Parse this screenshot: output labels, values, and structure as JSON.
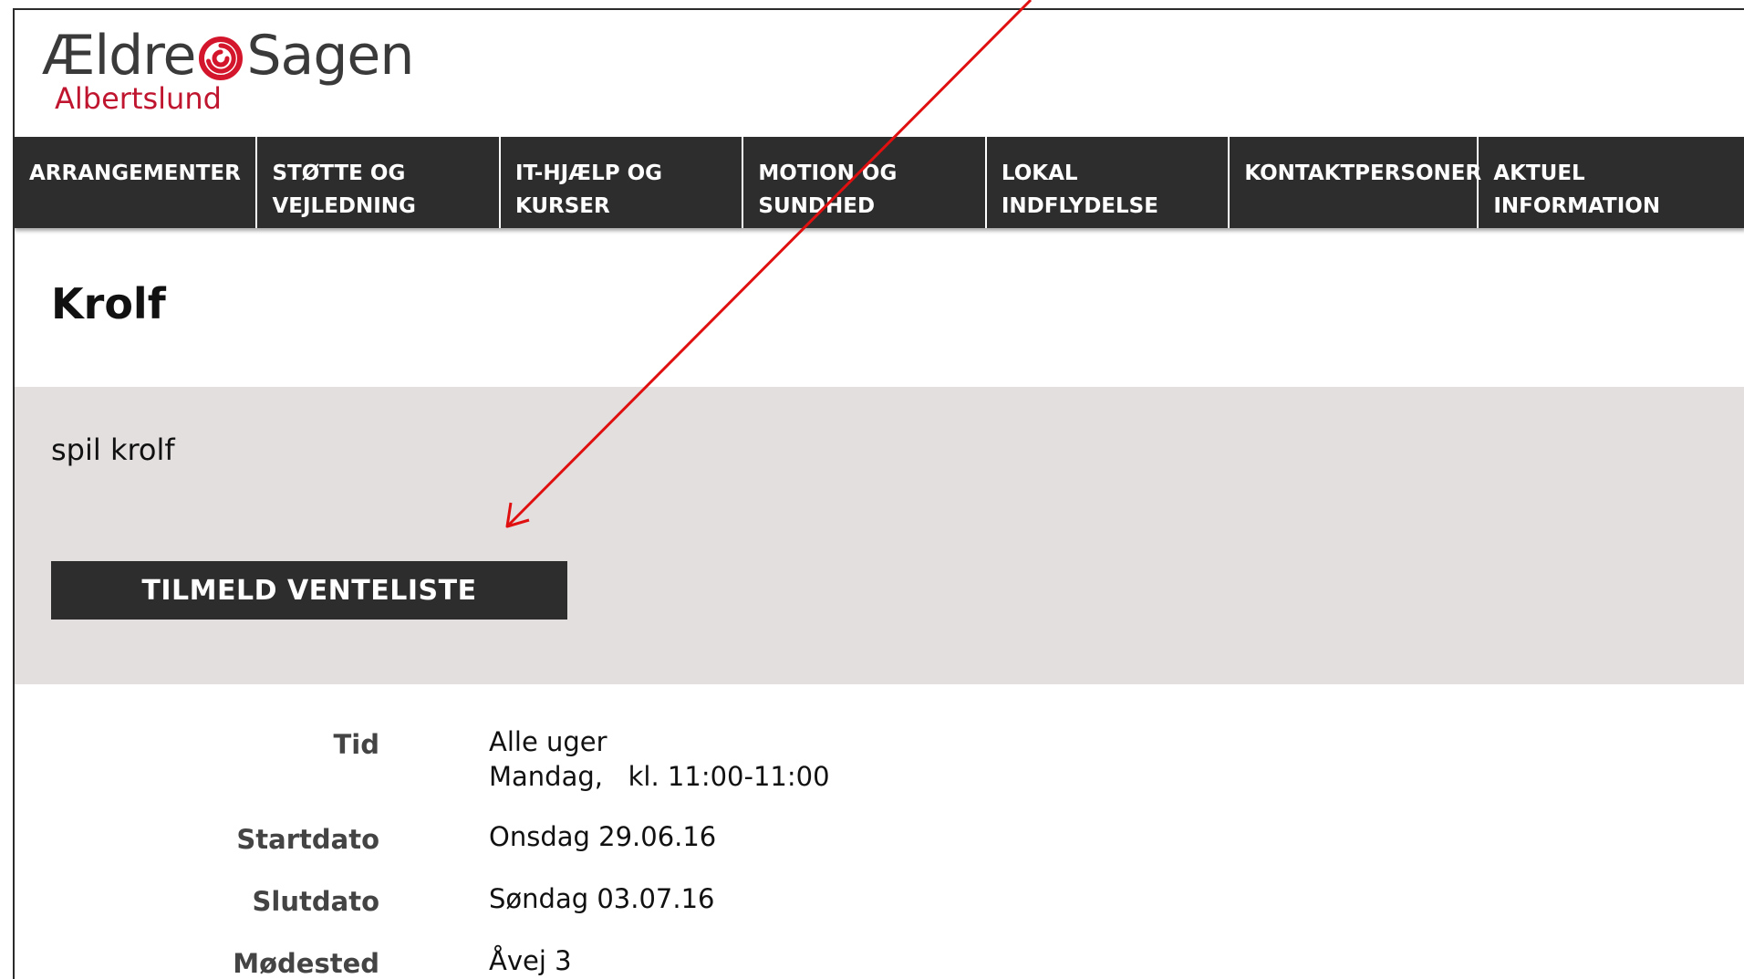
{
  "logo": {
    "brand_left": "Ældre",
    "brand_right": "Sagen",
    "chapter": "Albertslund",
    "swirl_color": "#d4162c"
  },
  "nav": {
    "items": [
      {
        "line1": "ARRANGEMENTER",
        "line2": ""
      },
      {
        "line1": "STØTTE OG",
        "line2": "VEJLEDNING"
      },
      {
        "line1": "IT-HJÆLP OG",
        "line2": "KURSER"
      },
      {
        "line1": "MOTION OG",
        "line2": "SUNDHED"
      },
      {
        "line1": "LOKAL",
        "line2": "INDFLYDELSE"
      },
      {
        "line1": "KONTAKTPERSONER",
        "line2": ""
      },
      {
        "line1": "AKTUEL",
        "line2": "INFORMATION"
      }
    ],
    "background": "#2d2d2d"
  },
  "page": {
    "title": "Krolf",
    "description": "spil krolf",
    "signup_button": "TILMELD VENTELISTE",
    "band_color": "#e3dfdf"
  },
  "details": {
    "time_label": "Tid",
    "time_line1": "Alle uger",
    "time_line2": "Mandag,   kl. 11:00-11:00",
    "start_label": "Startdato",
    "start_value": "Onsdag 29.06.16",
    "end_label": "Slutdato",
    "end_value": "Søndag 03.07.16",
    "place_label": "Mødested",
    "place_value": "Åvej 3"
  },
  "annotation": {
    "arrow_color": "#e01010"
  }
}
